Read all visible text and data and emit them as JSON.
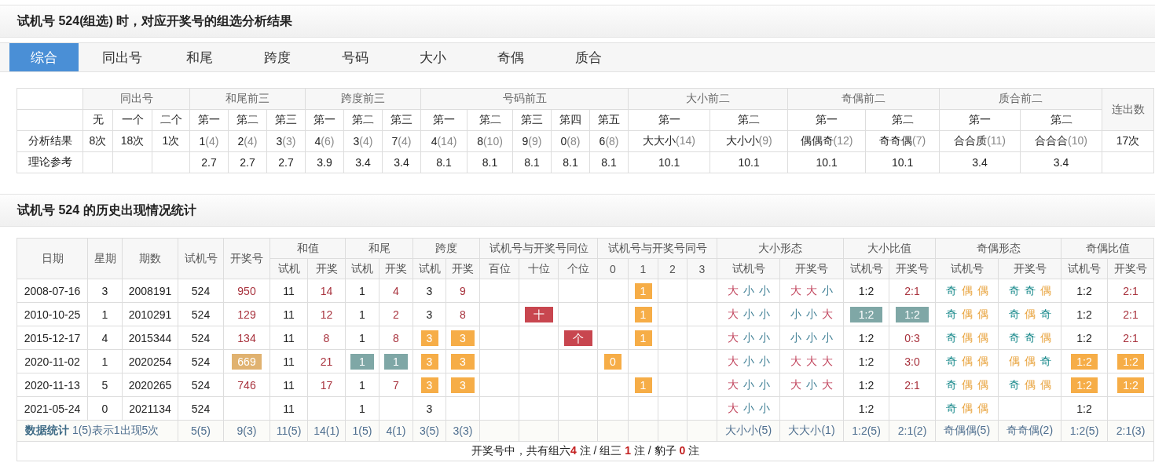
{
  "analysis_title": "试机号 524(组选) 时，对应开奖号的组选分析结果",
  "tabs": [
    {
      "label": "综合",
      "selected": true
    },
    {
      "label": "同出号",
      "selected": false
    },
    {
      "label": "和尾",
      "selected": false
    },
    {
      "label": "跨度",
      "selected": false
    },
    {
      "label": "号码",
      "selected": false
    },
    {
      "label": "大小",
      "selected": false
    },
    {
      "label": "奇偶",
      "selected": false
    },
    {
      "label": "质合",
      "selected": false
    }
  ],
  "summary": {
    "groups": [
      {
        "title": "同出号",
        "columns": [
          "无",
          "一个",
          "二个"
        ]
      },
      {
        "title": "和尾前三",
        "columns": [
          "第一",
          "第二",
          "第三"
        ]
      },
      {
        "title": "跨度前三",
        "columns": [
          "第一",
          "第二",
          "第三"
        ]
      },
      {
        "title": "号码前五",
        "columns": [
          "第一",
          "第二",
          "第三",
          "第四",
          "第五"
        ]
      },
      {
        "title": "大小前二",
        "columns": [
          "第一",
          "第二"
        ]
      },
      {
        "title": "奇偶前二",
        "columns": [
          "第一",
          "第二"
        ]
      },
      {
        "title": "质合前二",
        "columns": [
          "第一",
          "第二"
        ]
      }
    ],
    "last_column": "连出数",
    "rows": [
      {
        "label": "分析结果",
        "cells": [
          {
            "value": "8次"
          },
          {
            "value": "18次"
          },
          {
            "value": "1次"
          },
          {
            "value": "1",
            "count": "(4)"
          },
          {
            "value": "2",
            "count": "(4)"
          },
          {
            "value": "3",
            "count": "(3)"
          },
          {
            "value": "4",
            "count": "(6)"
          },
          {
            "value": "3",
            "count": "(4)"
          },
          {
            "value": "7",
            "count": "(4)"
          },
          {
            "value": "4",
            "count": "(14)"
          },
          {
            "value": "8",
            "count": "(10)"
          },
          {
            "value": "9",
            "count": "(9)"
          },
          {
            "value": "0",
            "count": "(8)"
          },
          {
            "value": "6",
            "count": "(8)"
          },
          {
            "value": "大大小",
            "count": "(14)"
          },
          {
            "value": "大小小",
            "count": "(9)"
          },
          {
            "value": "偶偶奇",
            "count": "(12)"
          },
          {
            "value": "奇奇偶",
            "count": "(7)"
          },
          {
            "value": "合合质",
            "count": "(11)"
          },
          {
            "value": "合合合",
            "count": "(10)"
          },
          {
            "value": "17次"
          }
        ]
      },
      {
        "label": "理论参考",
        "cells": [
          {},
          {},
          {},
          {
            "value": "2.7"
          },
          {
            "value": "2.7"
          },
          {
            "value": "2.7"
          },
          {
            "value": "3.9"
          },
          {
            "value": "3.4"
          },
          {
            "value": "3.4"
          },
          {
            "value": "8.1"
          },
          {
            "value": "8.1"
          },
          {
            "value": "8.1"
          },
          {
            "value": "8.1"
          },
          {
            "value": "8.1"
          },
          {
            "value": "10.1"
          },
          {
            "value": "10.1"
          },
          {
            "value": "10.1"
          },
          {
            "value": "10.1"
          },
          {
            "value": "3.4"
          },
          {
            "value": "3.4"
          },
          {}
        ]
      }
    ]
  },
  "history_title": "试机号 524 的历史出现情况统计",
  "history": {
    "header_row_1": [
      {
        "title": "日期",
        "rowspan": 2
      },
      {
        "title": "星期",
        "rowspan": 2
      },
      {
        "title": "期数",
        "rowspan": 2
      },
      {
        "title": "试机号",
        "rowspan": 2
      },
      {
        "title": "开奖号",
        "rowspan": 2
      },
      {
        "title": "和值",
        "colspan": 2
      },
      {
        "title": "和尾",
        "colspan": 2
      },
      {
        "title": "跨度",
        "colspan": 2
      },
      {
        "title": "试机号与开奖号同位",
        "colspan": 3
      },
      {
        "title": "试机号与开奖号同号",
        "colspan": 4
      },
      {
        "title": "大小形态",
        "colspan": 2
      },
      {
        "title": "大小比值",
        "colspan": 2
      },
      {
        "title": "奇偶形态",
        "colspan": 2
      },
      {
        "title": "奇偶比值",
        "colspan": 2
      }
    ],
    "header_row_2": [
      "试机",
      "开奖",
      "试机",
      "开奖",
      "试机",
      "开奖",
      "百位",
      "十位",
      "个位",
      "0",
      "1",
      "2",
      "3",
      "试机号",
      "开奖号",
      "试机号",
      "开奖号",
      "试机号",
      "开奖号",
      "试机号",
      "开奖号"
    ],
    "rows": [
      [
        {
          "text": "2008-07-16",
          "kind": "text"
        },
        {
          "text": "3",
          "kind": "text"
        },
        {
          "text": "2008191",
          "kind": "text"
        },
        {
          "text": "524",
          "kind": "text"
        },
        {
          "text": "950",
          "kind": "draw"
        },
        {
          "text": "11",
          "kind": "text"
        },
        {
          "text": "14",
          "kind": "draw"
        },
        {
          "text": "1",
          "kind": "text"
        },
        {
          "text": "4",
          "kind": "draw"
        },
        {
          "text": "3",
          "kind": "text"
        },
        {
          "text": "9",
          "kind": "draw"
        },
        {
          "kind": "blank"
        },
        {
          "kind": "blank"
        },
        {
          "kind": "blank"
        },
        {
          "kind": "blank"
        },
        {
          "text": "1",
          "kind": "orange"
        },
        {
          "kind": "blank"
        },
        {
          "kind": "blank"
        },
        {
          "kind": "shape",
          "chars": [
            {
              "text": "大",
              "kind": "big"
            },
            {
              "text": "小",
              "kind": "small"
            },
            {
              "text": "小",
              "kind": "small"
            }
          ]
        },
        {
          "kind": "shape",
          "chars": [
            {
              "text": "大",
              "kind": "big"
            },
            {
              "text": "大",
              "kind": "big"
            },
            {
              "text": "小",
              "kind": "small"
            }
          ]
        },
        {
          "text": "1:2",
          "kind": "text"
        },
        {
          "text": "2:1",
          "kind": "draw"
        },
        {
          "kind": "shape",
          "chars": [
            {
              "text": "奇",
              "kind": "odd"
            },
            {
              "text": "偶",
              "kind": "even"
            },
            {
              "text": "偶",
              "kind": "even"
            }
          ]
        },
        {
          "kind": "shape",
          "chars": [
            {
              "text": "奇",
              "kind": "odd"
            },
            {
              "text": "奇",
              "kind": "odd"
            },
            {
              "text": "偶",
              "kind": "even"
            }
          ]
        },
        {
          "text": "1:2",
          "kind": "text"
        },
        {
          "text": "2:1",
          "kind": "draw"
        }
      ],
      [
        {
          "text": "2010-10-25",
          "kind": "text"
        },
        {
          "text": "1",
          "kind": "text"
        },
        {
          "text": "2010291",
          "kind": "text"
        },
        {
          "text": "524",
          "kind": "text"
        },
        {
          "text": "129",
          "kind": "draw"
        },
        {
          "text": "11",
          "kind": "text"
        },
        {
          "text": "12",
          "kind": "draw"
        },
        {
          "text": "1",
          "kind": "text"
        },
        {
          "text": "2",
          "kind": "draw"
        },
        {
          "text": "3",
          "kind": "text"
        },
        {
          "text": "8",
          "kind": "draw"
        },
        {
          "kind": "blank"
        },
        {
          "text": "十",
          "kind": "red"
        },
        {
          "kind": "blank"
        },
        {
          "kind": "blank"
        },
        {
          "text": "1",
          "kind": "orange"
        },
        {
          "kind": "blank"
        },
        {
          "kind": "blank"
        },
        {
          "kind": "shape",
          "chars": [
            {
              "text": "大",
              "kind": "big"
            },
            {
              "text": "小",
              "kind": "small"
            },
            {
              "text": "小",
              "kind": "small"
            }
          ]
        },
        {
          "kind": "shape",
          "chars": [
            {
              "text": "小",
              "kind": "small"
            },
            {
              "text": "小",
              "kind": "small"
            },
            {
              "text": "大",
              "kind": "big"
            }
          ]
        },
        {
          "text": "1:2",
          "kind": "teal"
        },
        {
          "text": "1:2",
          "kind": "teal"
        },
        {
          "kind": "shape",
          "chars": [
            {
              "text": "奇",
              "kind": "odd"
            },
            {
              "text": "偶",
              "kind": "even"
            },
            {
              "text": "偶",
              "kind": "even"
            }
          ]
        },
        {
          "kind": "shape",
          "chars": [
            {
              "text": "奇",
              "kind": "odd"
            },
            {
              "text": "偶",
              "kind": "even"
            },
            {
              "text": "奇",
              "kind": "odd"
            }
          ]
        },
        {
          "text": "1:2",
          "kind": "text"
        },
        {
          "text": "2:1",
          "kind": "draw"
        }
      ],
      [
        {
          "text": "2015-12-17",
          "kind": "text"
        },
        {
          "text": "4",
          "kind": "text"
        },
        {
          "text": "2015344",
          "kind": "text"
        },
        {
          "text": "524",
          "kind": "text"
        },
        {
          "text": "134",
          "kind": "draw"
        },
        {
          "text": "11",
          "kind": "text"
        },
        {
          "text": "8",
          "kind": "draw"
        },
        {
          "text": "1",
          "kind": "text"
        },
        {
          "text": "8",
          "kind": "draw"
        },
        {
          "text": "3",
          "kind": "orange"
        },
        {
          "text": "3",
          "kind": "orange"
        },
        {
          "kind": "blank"
        },
        {
          "kind": "blank"
        },
        {
          "text": "个",
          "kind": "red"
        },
        {
          "kind": "blank"
        },
        {
          "text": "1",
          "kind": "orange"
        },
        {
          "kind": "blank"
        },
        {
          "kind": "blank"
        },
        {
          "kind": "shape",
          "chars": [
            {
              "text": "大",
              "kind": "big"
            },
            {
              "text": "小",
              "kind": "small"
            },
            {
              "text": "小",
              "kind": "small"
            }
          ]
        },
        {
          "kind": "shape",
          "chars": [
            {
              "text": "小",
              "kind": "small"
            },
            {
              "text": "小",
              "kind": "small"
            },
            {
              "text": "小",
              "kind": "small"
            }
          ]
        },
        {
          "text": "1:2",
          "kind": "text"
        },
        {
          "text": "0:3",
          "kind": "draw"
        },
        {
          "kind": "shape",
          "chars": [
            {
              "text": "奇",
              "kind": "odd"
            },
            {
              "text": "偶",
              "kind": "even"
            },
            {
              "text": "偶",
              "kind": "even"
            }
          ]
        },
        {
          "kind": "shape",
          "chars": [
            {
              "text": "奇",
              "kind": "odd"
            },
            {
              "text": "奇",
              "kind": "odd"
            },
            {
              "text": "偶",
              "kind": "even"
            }
          ]
        },
        {
          "text": "1:2",
          "kind": "text"
        },
        {
          "text": "2:1",
          "kind": "draw"
        }
      ],
      [
        {
          "text": "2020-11-02",
          "kind": "text"
        },
        {
          "text": "1",
          "kind": "text"
        },
        {
          "text": "2020254",
          "kind": "text"
        },
        {
          "text": "524",
          "kind": "text"
        },
        {
          "text": "669",
          "kind": "tan"
        },
        {
          "text": "11",
          "kind": "text"
        },
        {
          "text": "21",
          "kind": "draw"
        },
        {
          "text": "1",
          "kind": "teal"
        },
        {
          "text": "1",
          "kind": "teal"
        },
        {
          "text": "3",
          "kind": "orange"
        },
        {
          "text": "3",
          "kind": "orange"
        },
        {
          "kind": "blank"
        },
        {
          "kind": "blank"
        },
        {
          "kind": "blank"
        },
        {
          "text": "0",
          "kind": "orange"
        },
        {
          "kind": "blank"
        },
        {
          "kind": "blank"
        },
        {
          "kind": "blank"
        },
        {
          "kind": "shape",
          "chars": [
            {
              "text": "大",
              "kind": "big"
            },
            {
              "text": "小",
              "kind": "small"
            },
            {
              "text": "小",
              "kind": "small"
            }
          ]
        },
        {
          "kind": "shape",
          "chars": [
            {
              "text": "大",
              "kind": "big"
            },
            {
              "text": "大",
              "kind": "big"
            },
            {
              "text": "大",
              "kind": "big"
            }
          ]
        },
        {
          "text": "1:2",
          "kind": "text"
        },
        {
          "text": "3:0",
          "kind": "draw"
        },
        {
          "kind": "shape",
          "chars": [
            {
              "text": "奇",
              "kind": "odd"
            },
            {
              "text": "偶",
              "kind": "even"
            },
            {
              "text": "偶",
              "kind": "even"
            }
          ]
        },
        {
          "kind": "shape",
          "chars": [
            {
              "text": "偶",
              "kind": "even"
            },
            {
              "text": "偶",
              "kind": "even"
            },
            {
              "text": "奇",
              "kind": "odd"
            }
          ]
        },
        {
          "text": "1:2",
          "kind": "orange"
        },
        {
          "text": "1:2",
          "kind": "orange"
        }
      ],
      [
        {
          "text": "2020-11-13",
          "kind": "text"
        },
        {
          "text": "5",
          "kind": "text"
        },
        {
          "text": "2020265",
          "kind": "text"
        },
        {
          "text": "524",
          "kind": "text"
        },
        {
          "text": "746",
          "kind": "draw"
        },
        {
          "text": "11",
          "kind": "text"
        },
        {
          "text": "17",
          "kind": "draw"
        },
        {
          "text": "1",
          "kind": "text"
        },
        {
          "text": "7",
          "kind": "draw"
        },
        {
          "text": "3",
          "kind": "orange"
        },
        {
          "text": "3",
          "kind": "orange"
        },
        {
          "kind": "blank"
        },
        {
          "kind": "blank"
        },
        {
          "kind": "blank"
        },
        {
          "kind": "blank"
        },
        {
          "text": "1",
          "kind": "orange"
        },
        {
          "kind": "blank"
        },
        {
          "kind": "blank"
        },
        {
          "kind": "shape",
          "chars": [
            {
              "text": "大",
              "kind": "big"
            },
            {
              "text": "小",
              "kind": "small"
            },
            {
              "text": "小",
              "kind": "small"
            }
          ]
        },
        {
          "kind": "shape",
          "chars": [
            {
              "text": "大",
              "kind": "big"
            },
            {
              "text": "小",
              "kind": "small"
            },
            {
              "text": "大",
              "kind": "big"
            }
          ]
        },
        {
          "text": "1:2",
          "kind": "text"
        },
        {
          "text": "2:1",
          "kind": "draw"
        },
        {
          "kind": "shape",
          "chars": [
            {
              "text": "奇",
              "kind": "odd"
            },
            {
              "text": "偶",
              "kind": "even"
            },
            {
              "text": "偶",
              "kind": "even"
            }
          ]
        },
        {
          "kind": "shape",
          "chars": [
            {
              "text": "奇",
              "kind": "odd"
            },
            {
              "text": "偶",
              "kind": "even"
            },
            {
              "text": "偶",
              "kind": "even"
            }
          ]
        },
        {
          "text": "1:2",
          "kind": "orange"
        },
        {
          "text": "1:2",
          "kind": "orange"
        }
      ],
      [
        {
          "text": "2021-05-24",
          "kind": "text"
        },
        {
          "text": "0",
          "kind": "text"
        },
        {
          "text": "2021134",
          "kind": "text"
        },
        {
          "text": "524",
          "kind": "text"
        },
        {
          "kind": "blank"
        },
        {
          "text": "11",
          "kind": "text"
        },
        {
          "kind": "blank"
        },
        {
          "text": "1",
          "kind": "text"
        },
        {
          "kind": "blank"
        },
        {
          "text": "3",
          "kind": "text"
        },
        {
          "kind": "blank"
        },
        {
          "kind": "blank"
        },
        {
          "kind": "blank"
        },
        {
          "kind": "blank"
        },
        {
          "kind": "blank"
        },
        {
          "kind": "blank"
        },
        {
          "kind": "blank"
        },
        {
          "kind": "blank"
        },
        {
          "kind": "shape",
          "chars": [
            {
              "text": "大",
              "kind": "big"
            },
            {
              "text": "小",
              "kind": "small"
            },
            {
              "text": "小",
              "kind": "small"
            }
          ]
        },
        {
          "kind": "blank"
        },
        {
          "text": "1:2",
          "kind": "text"
        },
        {
          "kind": "blank"
        },
        {
          "kind": "shape",
          "chars": [
            {
              "text": "奇",
              "kind": "odd"
            },
            {
              "text": "偶",
              "kind": "even"
            },
            {
              "text": "偶",
              "kind": "even"
            }
          ]
        },
        {
          "kind": "blank"
        },
        {
          "text": "1:2",
          "kind": "text"
        },
        {
          "kind": "blank"
        }
      ]
    ],
    "stats_note": "**数据统计** 1(5)表示1出现5次",
    "stats": [
      {
        "text": "5(5)",
        "kind": "text"
      },
      {
        "text": "9(3)",
        "kind": "text"
      },
      {
        "text": "11(5)",
        "kind": "text"
      },
      {
        "text": "14(1)",
        "kind": "text"
      },
      {
        "text": "1(5)",
        "kind": "text"
      },
      {
        "text": "4(1)",
        "kind": "text"
      },
      {
        "text": "3(5)",
        "kind": "text"
      },
      {
        "text": "3(3)",
        "kind": "text"
      },
      {
        "kind": "blank"
      },
      {
        "kind": "blank"
      },
      {
        "kind": "blank"
      },
      {
        "kind": "blank"
      },
      {
        "kind": "blank"
      },
      {
        "kind": "blank"
      },
      {
        "kind": "blank"
      },
      {
        "text": "大小小(5)",
        "kind": "text"
      },
      {
        "text": "大大小(1)",
        "kind": "text"
      },
      {
        "text": "1:2(5)",
        "kind": "text"
      },
      {
        "text": "2:1(2)",
        "kind": "text"
      },
      {
        "text": "奇偶偶(5)",
        "kind": "text"
      },
      {
        "text": "奇奇偶(2)",
        "kind": "text"
      },
      {
        "text": "1:2(5)",
        "kind": "text"
      },
      {
        "text": "2:1(3)",
        "kind": "text"
      }
    ],
    "footer": "开奖号中，共有组六**4** 注 / 组三 **1** 注 / 豹子 **0** 注"
  }
}
